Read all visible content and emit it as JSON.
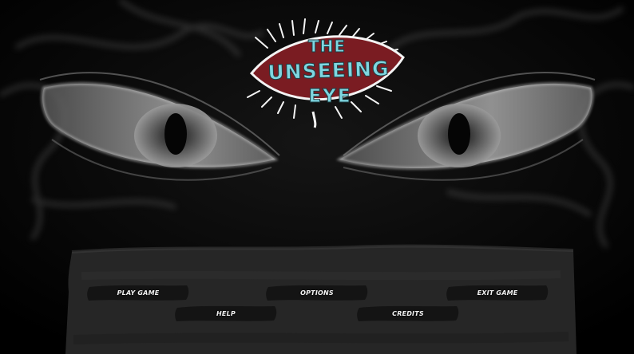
{
  "title": {
    "line1": "THE",
    "line2": "UNSEEING",
    "line3": "EYE"
  },
  "menu": {
    "play": "PLAY GAME",
    "options": "OPTIONS",
    "exit": "EXIT GAME",
    "help": "HELP",
    "credits": "CREDITS"
  },
  "colors": {
    "background": "#000000",
    "logo_fill": "#7a1c22",
    "logo_text": "#7fd6e0",
    "button": "#161616",
    "panel": "#262626"
  },
  "icons": [
    "left-eye-art",
    "right-eye-art",
    "smoke-art",
    "eye-logo"
  ]
}
